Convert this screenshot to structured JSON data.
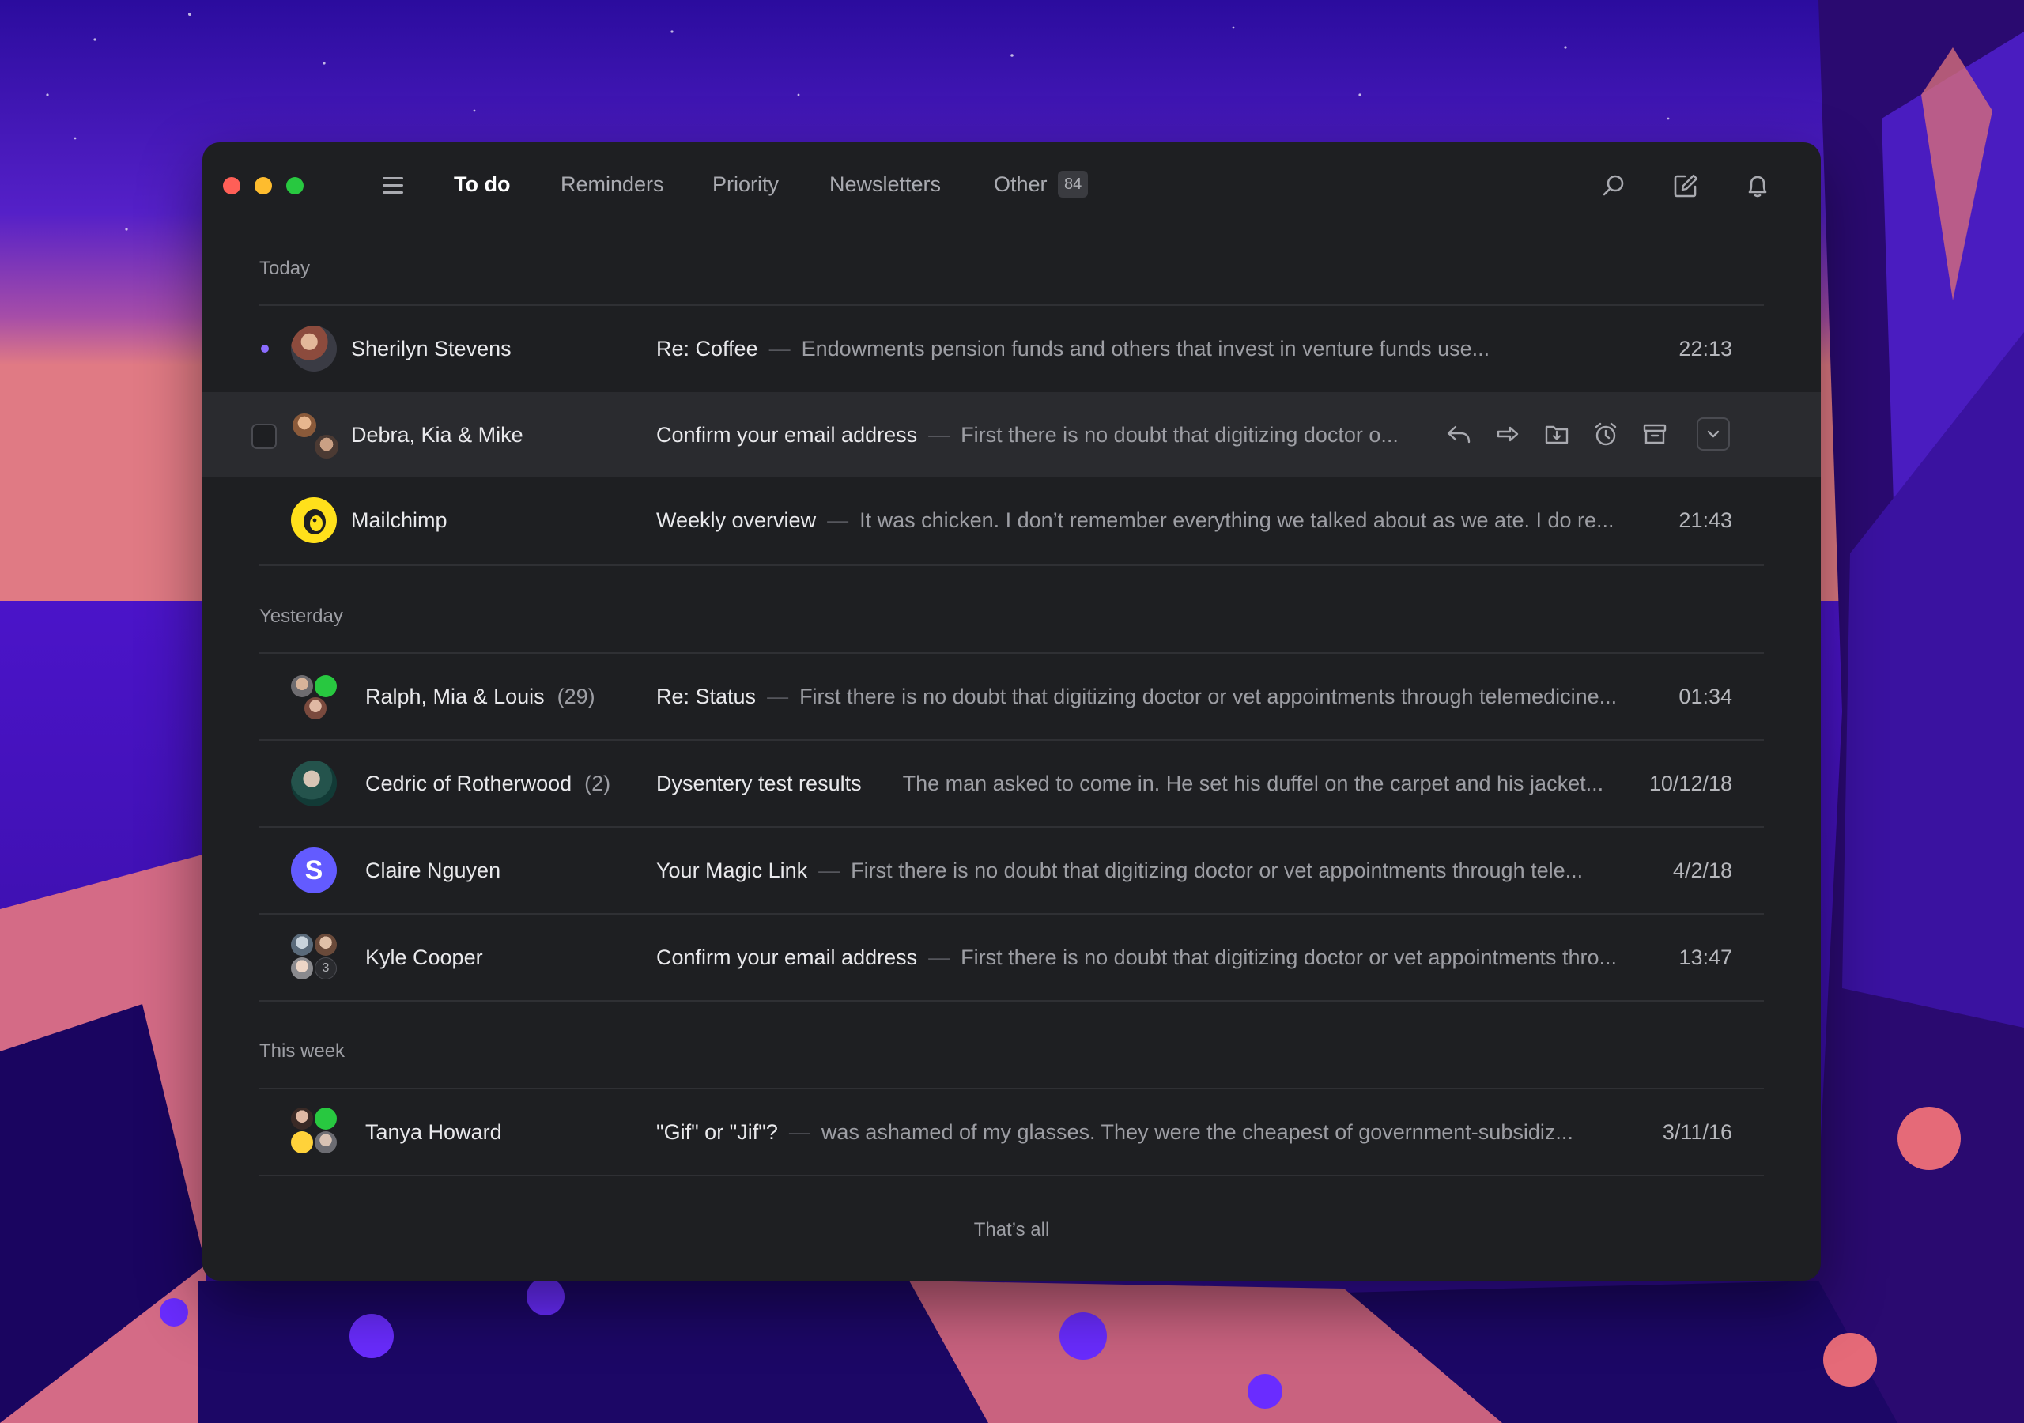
{
  "window": {
    "tabs": [
      {
        "label": "To do"
      },
      {
        "label": "Reminders"
      },
      {
        "label": "Priority"
      },
      {
        "label": "Newsletters"
      },
      {
        "label": "Other",
        "badge": "84"
      }
    ]
  },
  "sections": {
    "today": "Today",
    "yesterday": "Yesterday",
    "this_week": "This week"
  },
  "rows": [
    {
      "sender": "Sherilyn Stevens",
      "count": "",
      "subject": "Re: Coffee",
      "preview": "Endowments pension funds and others that invest in venture funds use...",
      "time": "22:13",
      "unread": true
    },
    {
      "sender": "Debra, Kia & Mike",
      "count": "",
      "subject": "Confirm your email address",
      "preview": "First there is no doubt that digitizing doctor o...",
      "time": ""
    },
    {
      "sender": "Mailchimp",
      "count": "",
      "subject": "Weekly overview",
      "preview": "It was chicken. I don’t remember everything we talked about as we ate. I do re...",
      "time": "21:43"
    },
    {
      "sender": "Ralph, Mia & Louis",
      "count": "(29)",
      "subject": "Re: Status",
      "preview": "First there is no doubt that digitizing doctor or vet appointments through telemedicine...",
      "time": "01:34"
    },
    {
      "sender": "Cedric of Rotherwood",
      "count": "(2)",
      "subject": "Dysentery test results",
      "preview": "The man asked to come in. He set his duffel on the carpet and his jacket...",
      "time": "10/12/18"
    },
    {
      "sender": "Claire Nguyen",
      "count": "",
      "subject": "Your Magic Link",
      "preview": "First there is no doubt that digitizing doctor or vet appointments through tele...",
      "time": "4/2/18"
    },
    {
      "sender": "Kyle Cooper",
      "count": "",
      "subject": "Confirm your email address",
      "preview": "First there is no doubt that digitizing doctor or vet appointments thro...",
      "time": "13:47",
      "avatar_badge": "3"
    },
    {
      "sender": "Tanya Howard",
      "count": "",
      "subject": "\"Gif\" or \"Jif\"?",
      "preview": "was ashamed of my glasses. They were the cheapest of government-subsidiz...",
      "time": "3/11/16"
    }
  ],
  "avatar_letters": {
    "claire": "S"
  },
  "dash": "—",
  "footer": "That’s all",
  "icons": [
    "menu-icon",
    "search-icon",
    "compose-icon",
    "bell-icon",
    "reply-icon",
    "forward-icon",
    "move-to-folder-icon",
    "snooze-clock-icon",
    "archive-icon",
    "chevron-down-icon"
  ],
  "colors": {
    "accent": "#8b6cff",
    "window_bg": "#1e1f22",
    "hover_row": "#2a2b2f",
    "close": "#ff5f57",
    "minimize": "#febc2e",
    "maximize": "#28c840"
  }
}
